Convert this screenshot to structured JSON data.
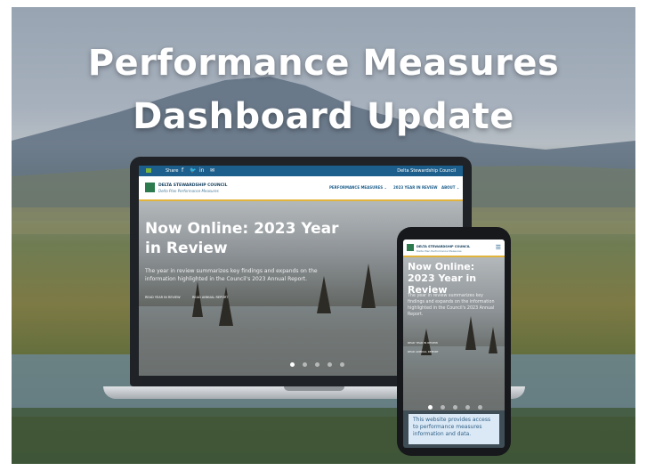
{
  "headline": {
    "line1": "Performance Measures",
    "line2": "Dashboard Update"
  },
  "laptop_site": {
    "topbar": {
      "share_label": "Share",
      "social_icons": [
        "f",
        "🐦",
        "in",
        "✉"
      ],
      "right_label": "Delta Stewardship Council"
    },
    "brand": {
      "name": "DELTA STEWARDSHIP COUNCIL",
      "subtitle": "Delta Plan Performance Measures"
    },
    "nav": [
      "PERFORMANCE MEASURES ⌄",
      "2023 YEAR IN REVIEW",
      "ABOUT ⌄"
    ],
    "hero": {
      "title": "Now Online: 2023 Year in Review",
      "text": "The year in review summarizes key findings and expands on the information highlighted in the Council's 2023 Annual Report.",
      "link1": "READ YEAR IN REVIEW",
      "link2": "READ ANNUAL REPORT"
    },
    "slides": {
      "count": 5,
      "active": 0
    }
  },
  "phone_site": {
    "brand": {
      "name": "DELTA STEWARDSHIP COUNCIL",
      "subtitle": "Delta Plan Performance Measures"
    },
    "menu_icon": "☰",
    "hero": {
      "title": "Now Online: 2023 Year in Review",
      "text": "The year in review summarizes key findings and expands on the information highlighted in the Council's 2023 Annual Report.",
      "link1": "READ YEAR IN REVIEW",
      "link2": "READ ANNUAL REPORT"
    },
    "slides": {
      "count": 5,
      "active": 0
    },
    "callout": "This website provides access to performance measures information and data."
  }
}
